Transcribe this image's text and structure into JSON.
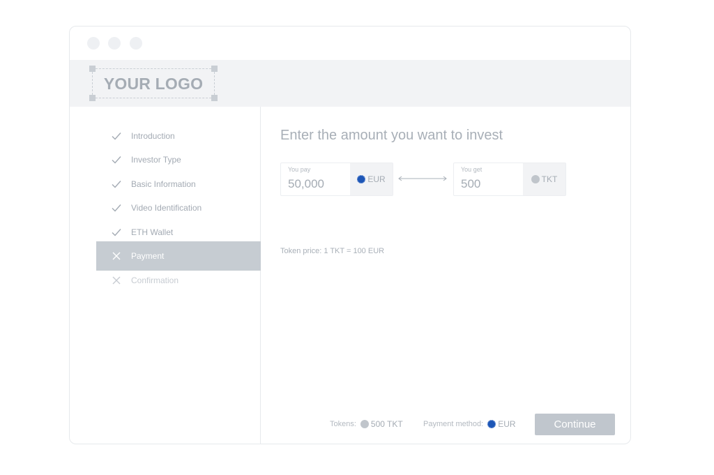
{
  "header": {
    "logo_text": "YOUR LOGO"
  },
  "steps": [
    {
      "label": "Introduction",
      "status": "done"
    },
    {
      "label": "Investor Type",
      "status": "done"
    },
    {
      "label": "Basic Information",
      "status": "done"
    },
    {
      "label": "Video Identification",
      "status": "done"
    },
    {
      "label": "ETH Wallet",
      "status": "done"
    },
    {
      "label": "Payment",
      "status": "active"
    },
    {
      "label": "Confirmation",
      "status": "pending"
    }
  ],
  "main": {
    "title": "Enter the amount you want to invest",
    "pay": {
      "label": "You pay",
      "value": "50,000",
      "currency": "EUR",
      "currency_icon": "eur-coin-icon"
    },
    "get": {
      "label": "You get",
      "value": "500",
      "currency": "TKT",
      "currency_icon": "token-coin-icon"
    },
    "token_price": "Token price: 1 TKT = 100 EUR"
  },
  "footer": {
    "tokens_label": "Tokens:",
    "tokens_value": "500 TKT",
    "payment_method_label": "Payment method:",
    "payment_method_value": "EUR",
    "continue_label": "Continue"
  },
  "colors": {
    "eur_coin": "#1d56b6",
    "token_coin": "#c0c5cb",
    "active_step": "#c6ccd2",
    "continue_button": "#c0c6cd"
  }
}
